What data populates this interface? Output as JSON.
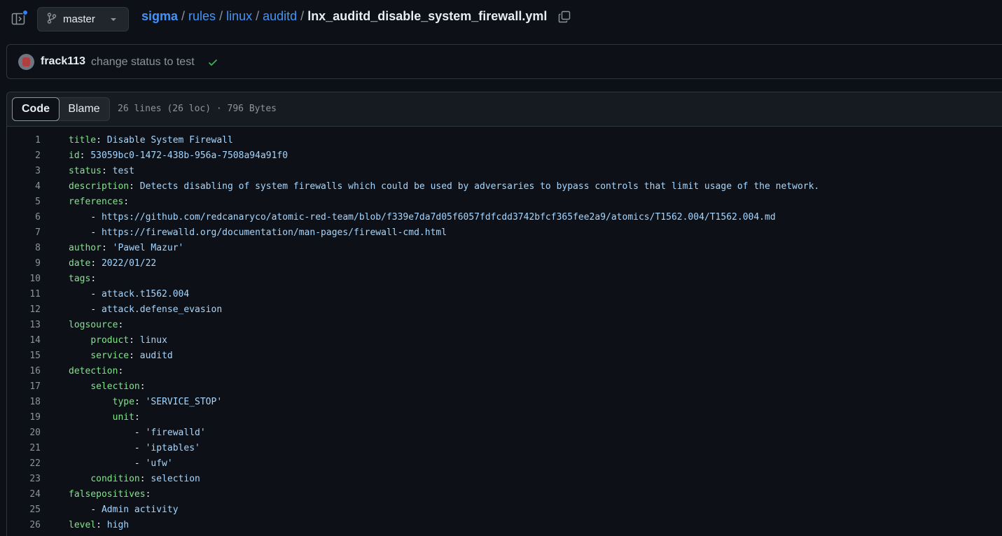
{
  "header": {
    "branch": "master",
    "breadcrumb": {
      "repo": "sigma",
      "dirs": [
        "rules",
        "linux",
        "auditd"
      ],
      "file": "lnx_auditd_disable_system_firewall.yml"
    }
  },
  "commit": {
    "author": "frack113",
    "message": "change status to test"
  },
  "file": {
    "tabs": {
      "code": "Code",
      "blame": "Blame"
    },
    "info": "26 lines (26 loc) · 796 Bytes"
  },
  "code_lines": [
    {
      "n": "1",
      "indent": "",
      "key": "title",
      "val": "Disable System Firewall"
    },
    {
      "n": "2",
      "indent": "",
      "key": "id",
      "val": "53059bc0-1472-438b-956a-7508a94a91f0"
    },
    {
      "n": "3",
      "indent": "",
      "key": "status",
      "val": "test"
    },
    {
      "n": "4",
      "indent": "",
      "key": "description",
      "val": "Detects disabling of system firewalls which could be used by adversaries to bypass controls that limit usage of the network."
    },
    {
      "n": "5",
      "indent": "",
      "key": "references",
      "val": ""
    },
    {
      "n": "6",
      "indent": "    ",
      "dash": true,
      "val": "https://github.com/redcanaryco/atomic-red-team/blob/f339e7da7d05f6057fdfcdd3742bfcf365fee2a9/atomics/T1562.004/T1562.004.md"
    },
    {
      "n": "7",
      "indent": "    ",
      "dash": true,
      "val": "https://firewalld.org/documentation/man-pages/firewall-cmd.html"
    },
    {
      "n": "8",
      "indent": "",
      "key": "author",
      "val": "'Pawel Mazur'"
    },
    {
      "n": "9",
      "indent": "",
      "key": "date",
      "val": "2022/01/22"
    },
    {
      "n": "10",
      "indent": "",
      "key": "tags",
      "val": ""
    },
    {
      "n": "11",
      "indent": "    ",
      "dash": true,
      "val": "attack.t1562.004"
    },
    {
      "n": "12",
      "indent": "    ",
      "dash": true,
      "val": "attack.defense_evasion"
    },
    {
      "n": "13",
      "indent": "",
      "key": "logsource",
      "val": ""
    },
    {
      "n": "14",
      "indent": "    ",
      "key": "product",
      "val": "linux"
    },
    {
      "n": "15",
      "indent": "    ",
      "key": "service",
      "val": "auditd"
    },
    {
      "n": "16",
      "indent": "",
      "key": "detection",
      "val": ""
    },
    {
      "n": "17",
      "indent": "    ",
      "key": "selection",
      "val": ""
    },
    {
      "n": "18",
      "indent": "        ",
      "key": "type",
      "val": "'SERVICE_STOP'"
    },
    {
      "n": "19",
      "indent": "        ",
      "key": "unit",
      "val": ""
    },
    {
      "n": "20",
      "indent": "            ",
      "dash": true,
      "val": "'firewalld'"
    },
    {
      "n": "21",
      "indent": "            ",
      "dash": true,
      "val": "'iptables'"
    },
    {
      "n": "22",
      "indent": "            ",
      "dash": true,
      "val": "'ufw'"
    },
    {
      "n": "23",
      "indent": "    ",
      "key": "condition",
      "val": "selection"
    },
    {
      "n": "24",
      "indent": "",
      "key": "falsepositives",
      "val": ""
    },
    {
      "n": "25",
      "indent": "    ",
      "dash": true,
      "val": "Admin activity"
    },
    {
      "n": "26",
      "indent": "",
      "key": "level",
      "val": "high"
    }
  ]
}
